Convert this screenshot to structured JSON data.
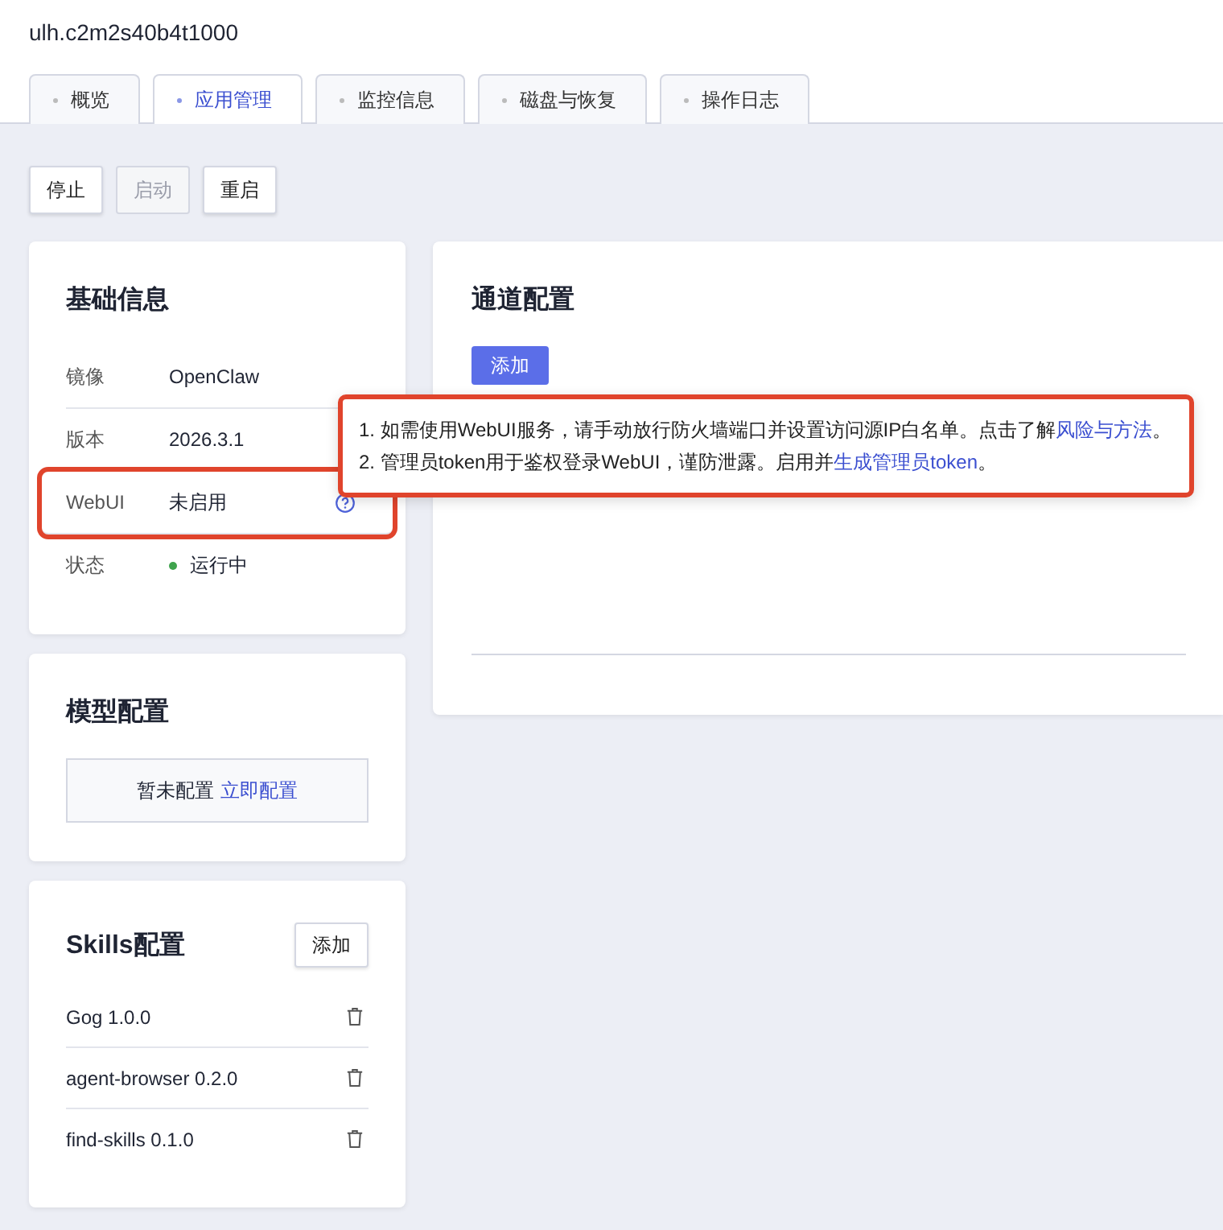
{
  "header": {
    "title": "ulh.c2m2s40b4t1000"
  },
  "tabs": [
    {
      "label": "概览",
      "selected": false
    },
    {
      "label": "应用管理",
      "selected": true
    },
    {
      "label": "监控信息",
      "selected": false
    },
    {
      "label": "磁盘与恢复",
      "selected": false
    },
    {
      "label": "操作日志",
      "selected": false
    }
  ],
  "actions": [
    {
      "label": "停止",
      "disabled": false
    },
    {
      "label": "启动",
      "disabled": true
    },
    {
      "label": "重启",
      "disabled": false
    }
  ],
  "basic_info": {
    "title": "基础信息",
    "rows": [
      {
        "kind": "text",
        "label": "镜像",
        "value": "OpenClaw",
        "highlighted": false
      },
      {
        "kind": "text",
        "label": "版本",
        "value": "2026.3.1",
        "highlighted": false
      },
      {
        "kind": "help",
        "label": "WebUI",
        "value": "未启用",
        "highlighted": true
      },
      {
        "kind": "status",
        "label": "状态",
        "value": "运行中",
        "highlighted": false
      }
    ]
  },
  "model_config": {
    "title": "模型配置",
    "empty_text": "暂未配置",
    "link": "立即配置"
  },
  "skills": {
    "title": "Skills配置",
    "add_button": "添加",
    "items": [
      "Gog 1.0.0",
      "agent-browser 0.2.0",
      "find-skills 0.1.0"
    ]
  },
  "channel_config": {
    "title": "通道配置",
    "add_button": "添加"
  },
  "tooltip": {
    "highlighted": true,
    "lines": [
      {
        "text": "1. 如需使用WebUI服务，请手动放行防火墙端口并设置访问源IP白名单。点击了解",
        "link": "风险与方法",
        "end": "。"
      },
      {
        "text": "2. 管理员token用于鉴权登录WebUI，谨防泄露。启用并",
        "link": "生成管理员token",
        "end": "。"
      }
    ]
  }
}
